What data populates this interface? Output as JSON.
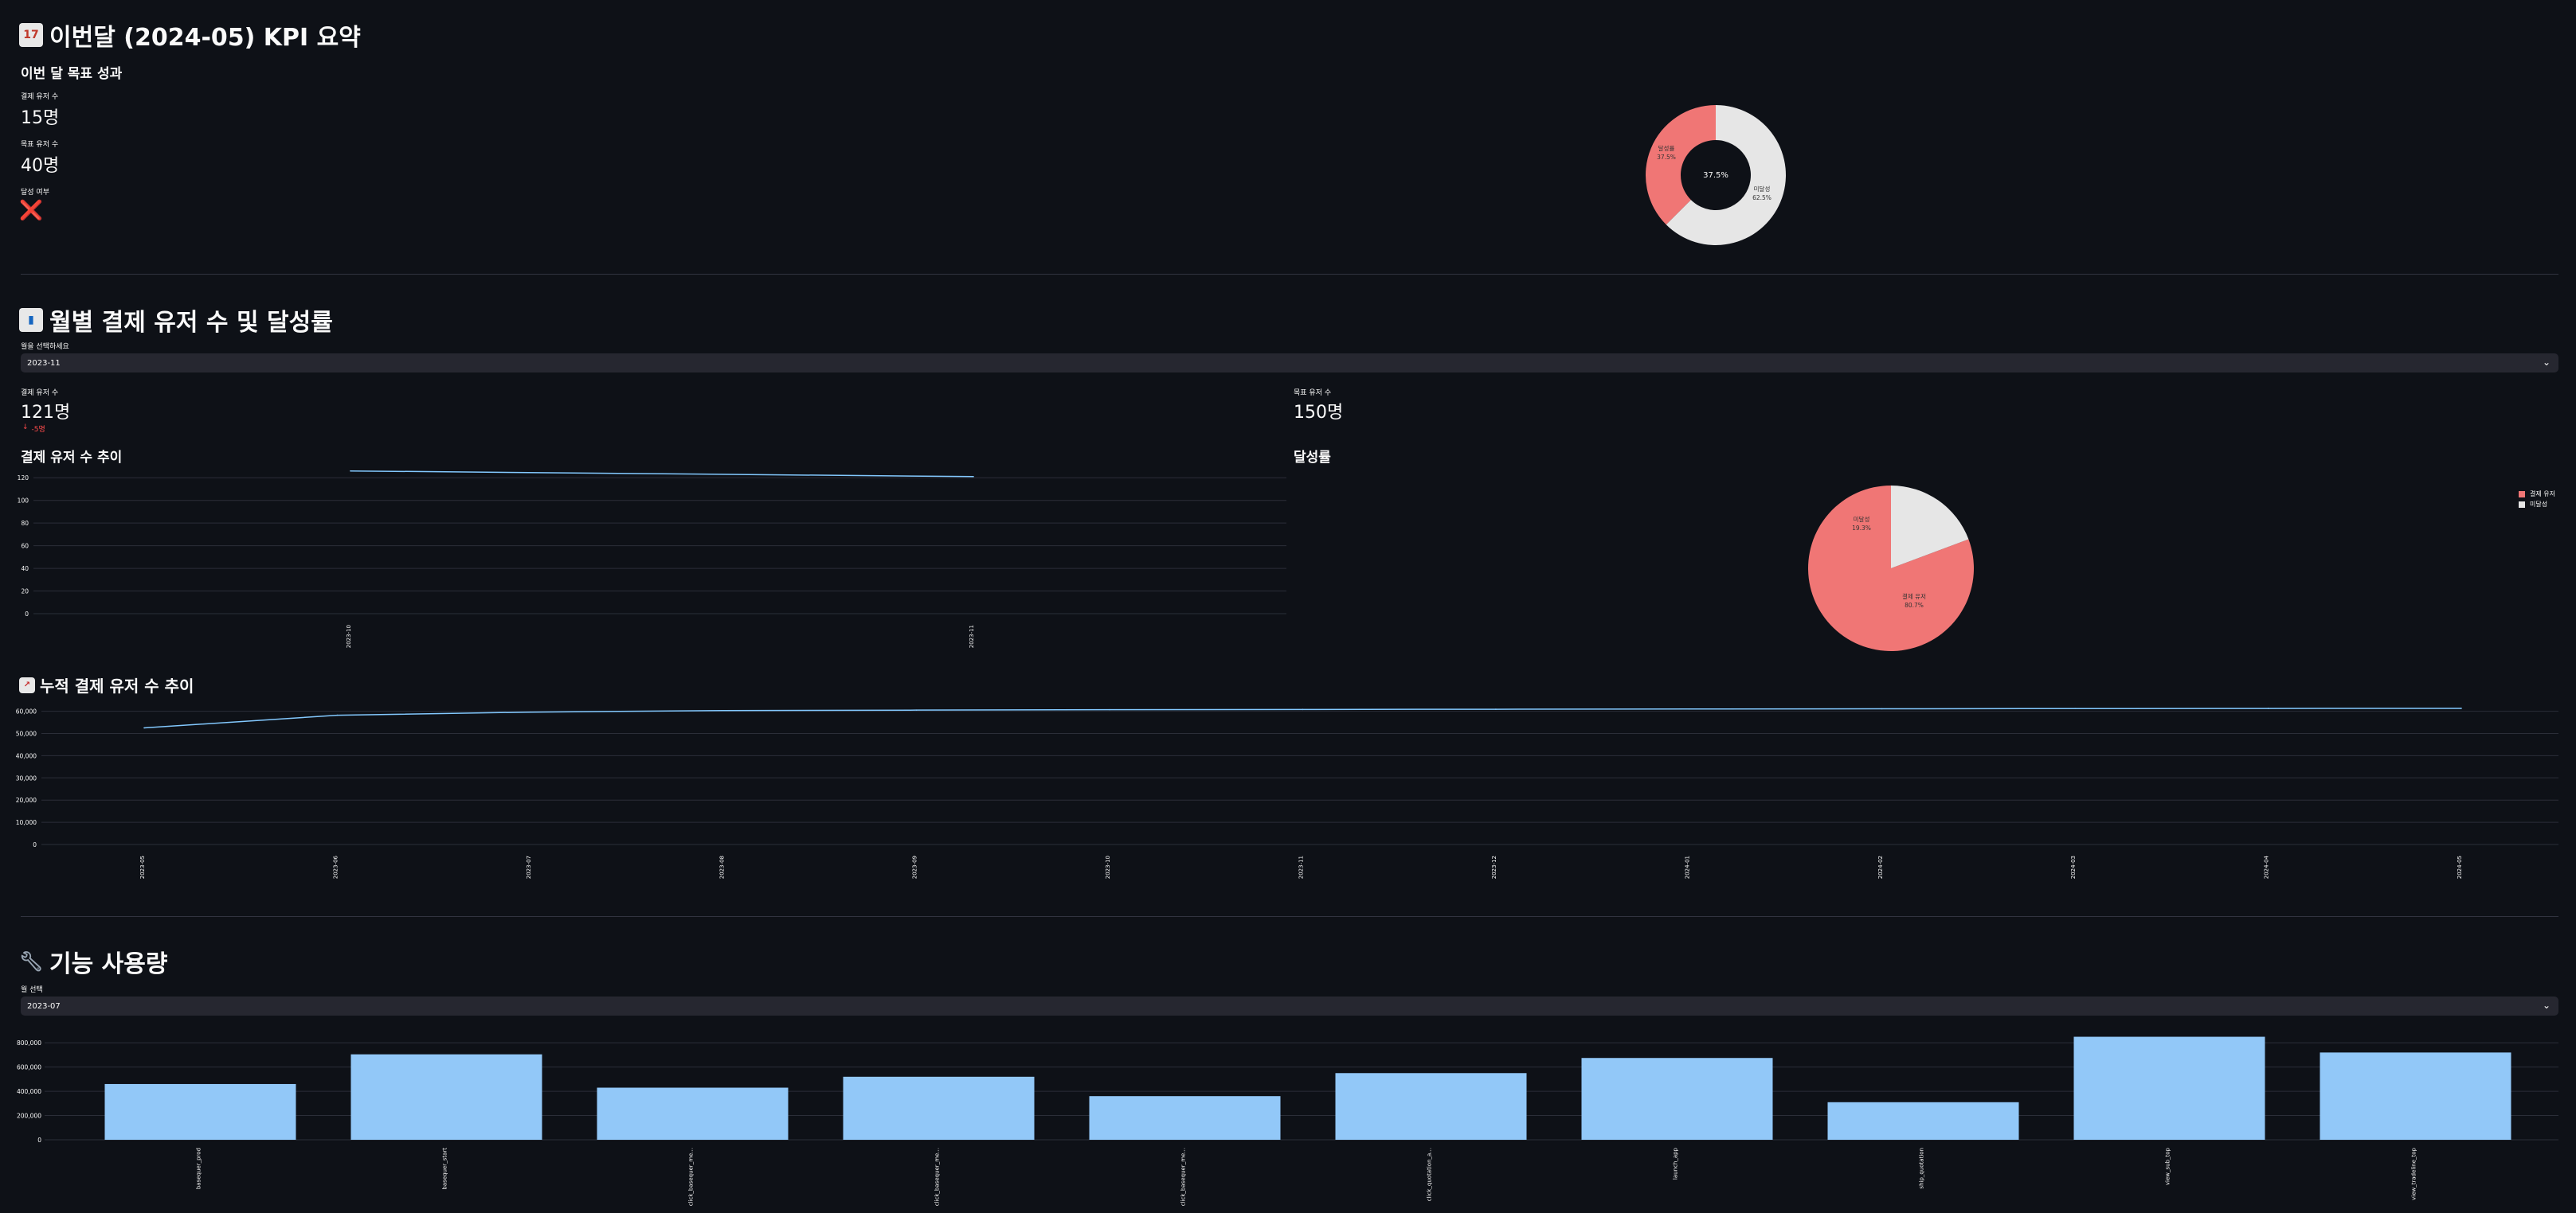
{
  "kpi": {
    "title": "이번달 (2024-05) KPI 요약",
    "subtitle": "이번 달 목표 성과",
    "metrics": [
      {
        "label": "결제 유저 수",
        "value": "15명"
      },
      {
        "label": "목표 유저 수",
        "value": "40명"
      },
      {
        "label": "달성 여부",
        "value": "❌"
      }
    ],
    "donut": {
      "center": "37.5%",
      "achieved_label": "달성률",
      "achieved_pct": "37.5%",
      "rest_label": "미달성",
      "rest_pct": "62.5%",
      "achieved_value": 37.5
    }
  },
  "monthly": {
    "title": "월별 결제 유저 수 및 달성률",
    "select_label": "월을 선택하세요",
    "select_value": "2023-11",
    "metric_paid_label": "결제 유저 수",
    "metric_paid_value": "121명",
    "metric_paid_delta": "-5명",
    "metric_target_label": "목표 유저 수",
    "metric_target_value": "150명",
    "trend_title": "결제 유저 수 추이",
    "rate_title": "달성률",
    "pie": {
      "paid_label": "결제 유저",
      "paid_pct": "80.7%",
      "rest_label": "미달성",
      "rest_pct": "19.3%",
      "paid_value": 80.7
    },
    "legend": [
      "결제 유저",
      "미달성"
    ]
  },
  "cumulative": {
    "title": "누적 결제 유저 수 추이"
  },
  "feature": {
    "title": "기능 사용량",
    "select_label": "월 선택",
    "select_value": "2023-07"
  },
  "colors": {
    "line": "#83c9ff",
    "bar": "#92c8f8",
    "pie_red": "#f07675",
    "pie_grey": "#e6e6e6"
  },
  "chart_data": [
    {
      "type": "line",
      "title": "결제 유저 수 추이",
      "x": [
        "2023-10",
        "2023-11"
      ],
      "values": [
        126,
        121
      ],
      "yticks": [
        0,
        20,
        40,
        60,
        80,
        100,
        120
      ],
      "ylim": [
        0,
        130
      ]
    },
    {
      "type": "line",
      "title": "누적 결제 유저 수 추이",
      "x": [
        "2023-05",
        "2023-06",
        "2023-07",
        "2023-08",
        "2023-09",
        "2023-10",
        "2023-11",
        "2023-12",
        "2024-01",
        "2024-02",
        "2024-03",
        "2024-04",
        "2024-05"
      ],
      "values": [
        52500,
        58200,
        59600,
        60300,
        60500,
        60700,
        60800,
        60900,
        61000,
        61100,
        61200,
        61250,
        61300
      ],
      "yticks": [
        "0",
        "10,000",
        "20,000",
        "30,000",
        "40,000",
        "50,000",
        "60,000"
      ],
      "ylim": [
        0,
        62000
      ]
    },
    {
      "type": "bar",
      "title": "",
      "categories": [
        "basequer_prod",
        "basequer_start",
        "click_basequer_me...",
        "click_basequer_me...",
        "click_basequer_me...",
        "click_quotation_a...",
        "launch_app",
        "ship_quotation",
        "view_sub_top",
        "view_tradeline_top"
      ],
      "values": [
        460000,
        705000,
        430000,
        520000,
        360000,
        550000,
        675000,
        310000,
        850000,
        720000
      ],
      "yticks": [
        "0",
        "200,000",
        "400,000",
        "600,000",
        "800,000"
      ],
      "ylim": [
        0,
        880000
      ]
    }
  ]
}
